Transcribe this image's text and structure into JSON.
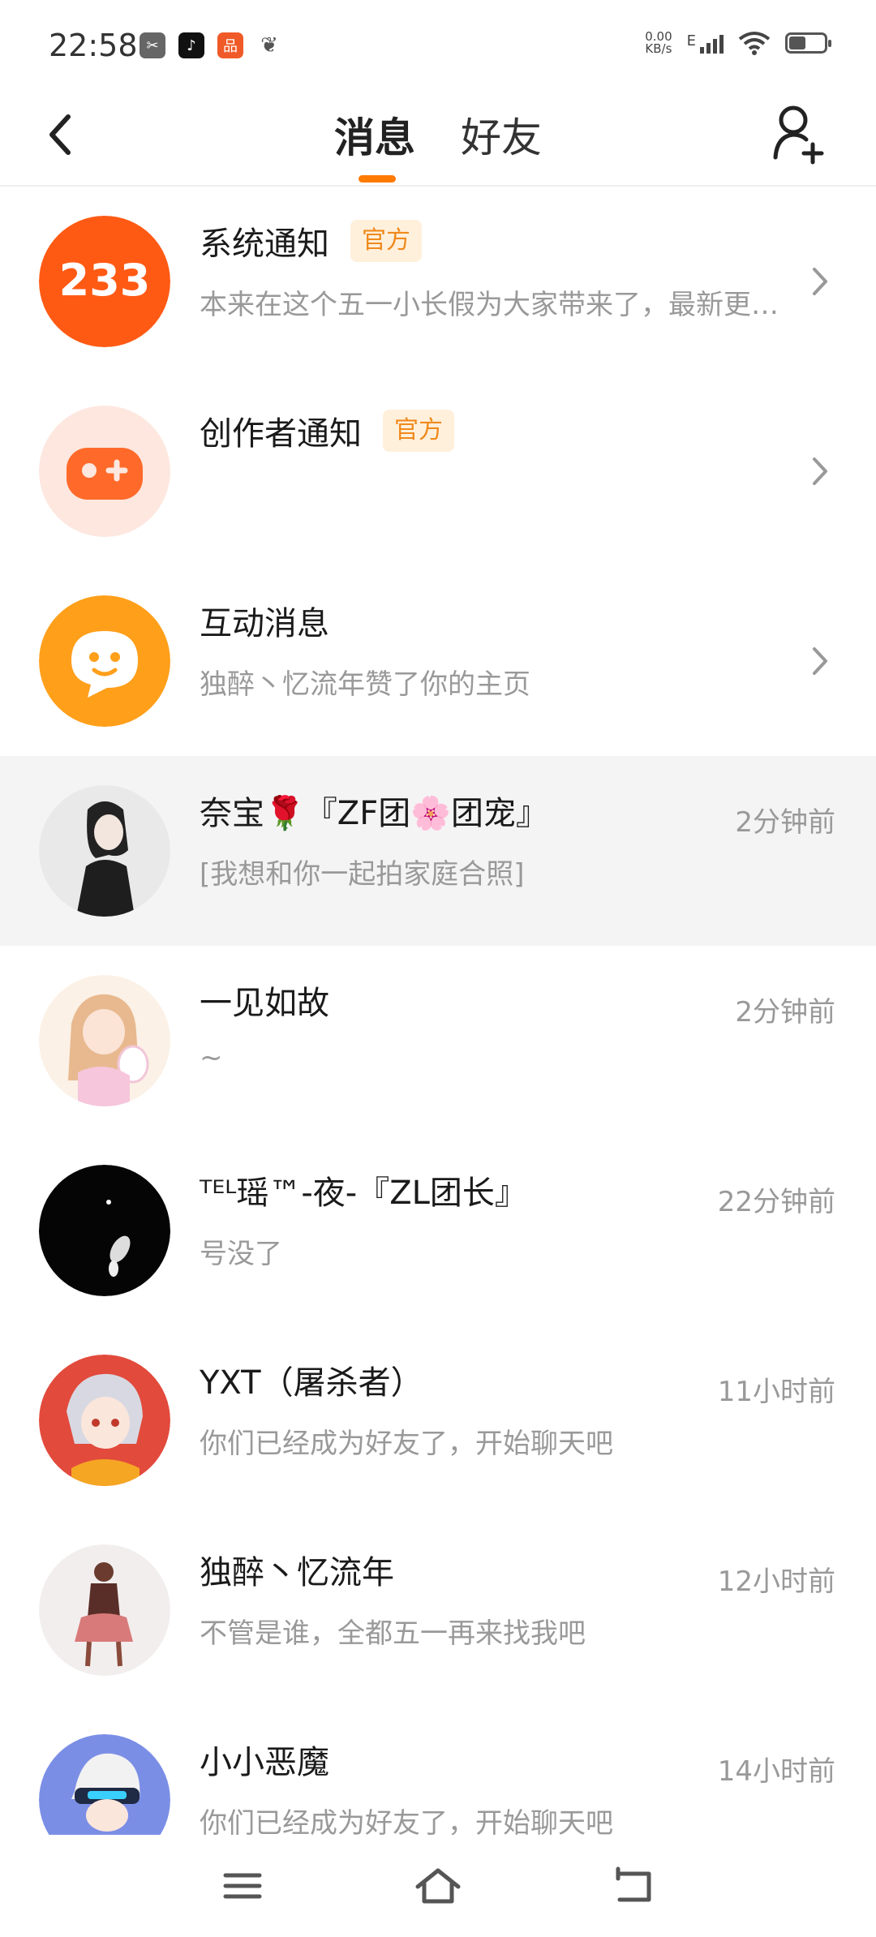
{
  "status_bar": {
    "time": "22:58",
    "speed_value": "0.00",
    "speed_unit": "KB/s",
    "network_type": "E",
    "battery_percent": 45,
    "icons": [
      "scissors-app-icon",
      "tiktok-app-icon",
      "shopping-app-icon",
      "leaf-app-icon",
      "signal-icon",
      "wifi-icon",
      "battery-icon"
    ]
  },
  "header": {
    "tabs": [
      {
        "label": "消息",
        "active": true
      },
      {
        "label": "好友",
        "active": false
      }
    ],
    "accent_color": "#ff7a00"
  },
  "conversations": [
    {
      "title": "系统通知",
      "badge": "官方",
      "subtitle": "本来在这个五一小长假为大家带来了，最新更新…",
      "time": "",
      "has_chevron": true,
      "avatar": "233-logo"
    },
    {
      "title": "创作者通知",
      "badge": "官方",
      "subtitle": "",
      "time": "",
      "has_chevron": true,
      "avatar": "gamepad-logo"
    },
    {
      "title": "互动消息",
      "badge": "",
      "subtitle": "独醉丶忆流年赞了你的主页",
      "time": "",
      "has_chevron": true,
      "avatar": "chat-bubble-logo"
    },
    {
      "title": "奈宝🌹『ZF团🌸团宠』",
      "badge": "",
      "subtitle": "[我想和你一起拍家庭合照]",
      "time": "2分钟前",
      "has_chevron": false,
      "avatar": "user-avatar",
      "highlighted": true
    },
    {
      "title": "一见如故",
      "badge": "",
      "subtitle": "~",
      "time": "2分钟前",
      "has_chevron": false,
      "avatar": "user-avatar"
    },
    {
      "title": "ᵀᴱᴸ瑶™-夜-『ZL团长』",
      "badge": "",
      "subtitle": "号没了",
      "time": "22分钟前",
      "has_chevron": false,
      "avatar": "user-avatar"
    },
    {
      "title": "YXT（屠杀者）",
      "badge": "",
      "subtitle": "你们已经成为好友了，开始聊天吧",
      "time": "11小时前",
      "has_chevron": false,
      "avatar": "user-avatar"
    },
    {
      "title": "独醉丶忆流年",
      "badge": "",
      "subtitle": "不管是谁，全都五一再来找我吧",
      "time": "12小时前",
      "has_chevron": false,
      "avatar": "user-avatar"
    },
    {
      "title": "小小恶魔",
      "badge": "",
      "subtitle": "你们已经成为好友了，开始聊天吧",
      "time": "14小时前",
      "has_chevron": false,
      "avatar": "user-avatar"
    }
  ],
  "nav_bar": {
    "icons": [
      "menu-icon",
      "home-icon",
      "back-nav-icon"
    ]
  }
}
